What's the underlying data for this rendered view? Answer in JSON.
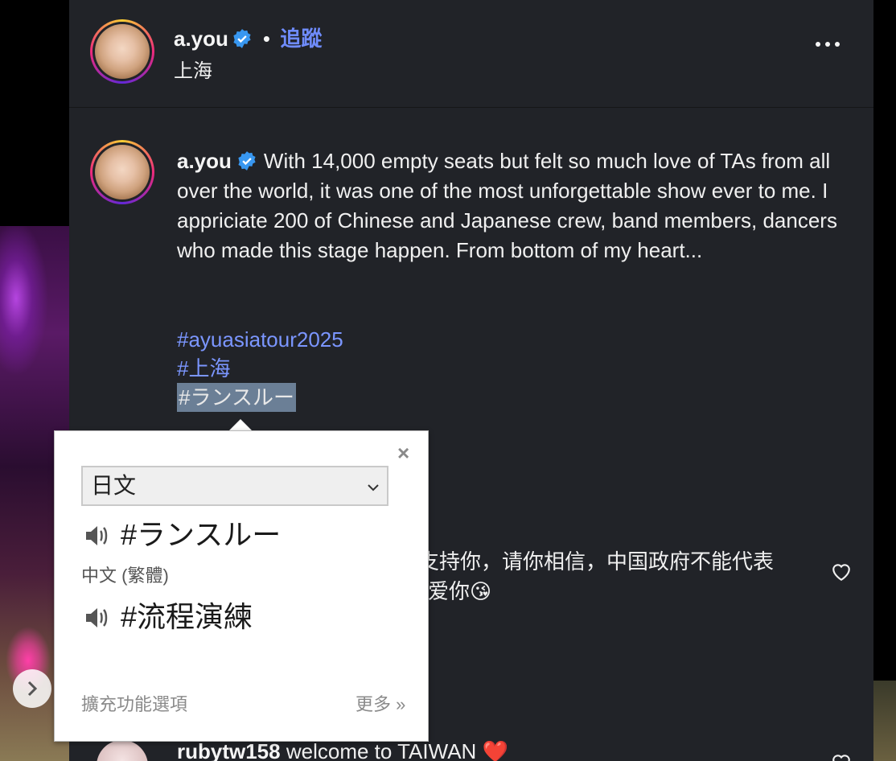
{
  "post_header": {
    "username": "a.you",
    "follow_label": "追蹤",
    "separator": "•",
    "location": "上海"
  },
  "caption": {
    "username": "a.you",
    "text": "With 14,000 empty seats but felt so much love of TAs from all over the world, it was one of the most unforgettable show ever to me. I appriciate 200 of Chinese and Japanese crew, band members, dancers who made this stage happen. From bottom of my heart...",
    "hashtags": [
      "#ayuasiatour2025",
      "#上海",
      "#ランスルー"
    ]
  },
  "comments": [
    {
      "line1": "支持你，请你相信，中国政府不能代表",
      "line2": "爱你😘"
    },
    {
      "username": "rubytw158",
      "text": "welcome to TAIWAN ❤️"
    }
  ],
  "translate_popup": {
    "source_language": "日文",
    "source_text": "#ランスルー",
    "target_language": "中文 (繁體)",
    "translated_text": "#流程演練",
    "close_label": "×",
    "extension_options_label": "擴充功能選項",
    "more_label": "更多 »"
  },
  "colors": {
    "accent_link": "#7b96ff",
    "panel_bg": "#212328",
    "verified_blue": "#3897f0"
  },
  "icons": [
    "verified-badge-icon",
    "more-options-icon",
    "heart-icon",
    "speaker-icon",
    "chevron-right-icon",
    "chevron-down-icon",
    "close-icon"
  ]
}
